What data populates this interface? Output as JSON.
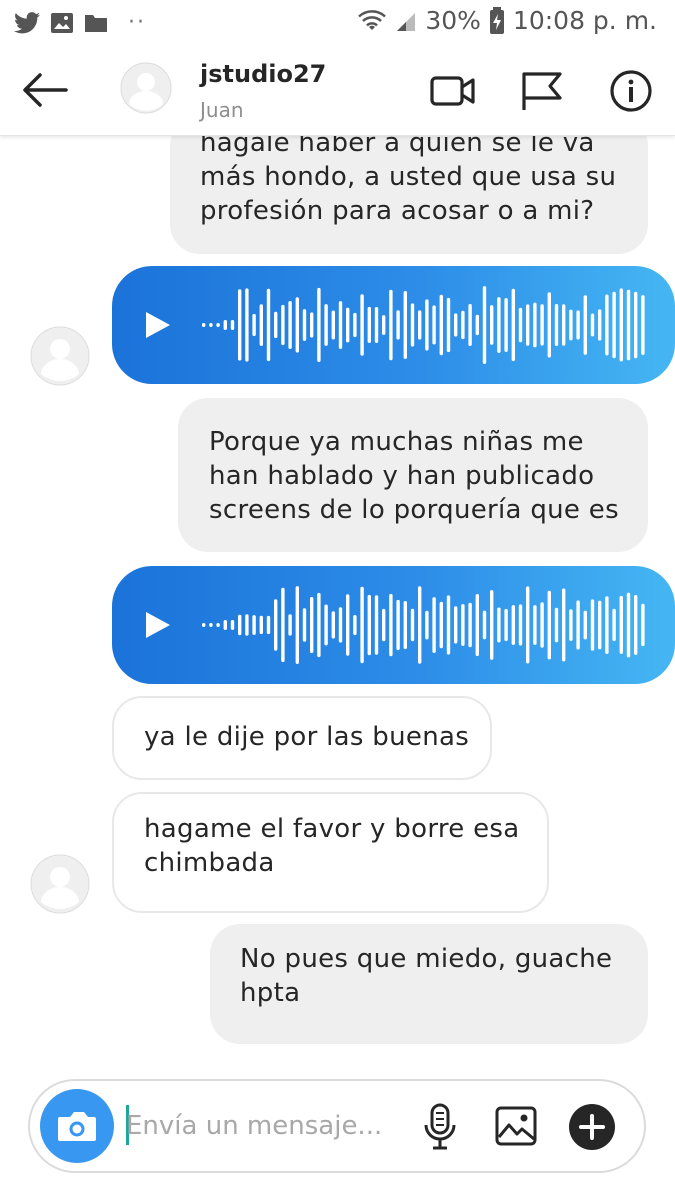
{
  "status_bar": {
    "battery": "30%",
    "time": "10:08 p. m.",
    "more_indicator": "··"
  },
  "header": {
    "username": "jstudio27",
    "subtitle": "Juan",
    "icons": [
      "back-arrow-icon",
      "video-call-icon",
      "flag-icon",
      "info-icon"
    ]
  },
  "messages": [
    {
      "type": "text",
      "direction": "sent",
      "lines": [
        "hagale haber a quien se le va",
        "más hondo, a usted que usa su",
        "profesión para acosar o a mi?"
      ]
    },
    {
      "type": "voice",
      "direction": "sent"
    },
    {
      "type": "text",
      "direction": "sent",
      "lines": [
        "Porque ya muchas niñas me",
        "han hablado y han publicado",
        "screens de lo porquería que es"
      ]
    },
    {
      "type": "voice",
      "direction": "sent"
    },
    {
      "type": "text",
      "direction": "received",
      "lines": [
        "ya le dije por las buenas"
      ]
    },
    {
      "type": "text",
      "direction": "received",
      "lines": [
        "hagame el favor y borre esa",
        "chimbada"
      ]
    },
    {
      "type": "text",
      "direction": "sent",
      "lines": [
        "No pues que miedo, guache",
        "hpta"
      ]
    }
  ],
  "composer": {
    "placeholder": "Envía un mensaje...",
    "value": ""
  },
  "colors": {
    "voice_gradient_start": "#1b73d9",
    "voice_gradient_end": "#45b6f3",
    "camera_button": "#3897f0",
    "sent_bubble": "#efefef",
    "received_border": "#e8e8e8"
  }
}
